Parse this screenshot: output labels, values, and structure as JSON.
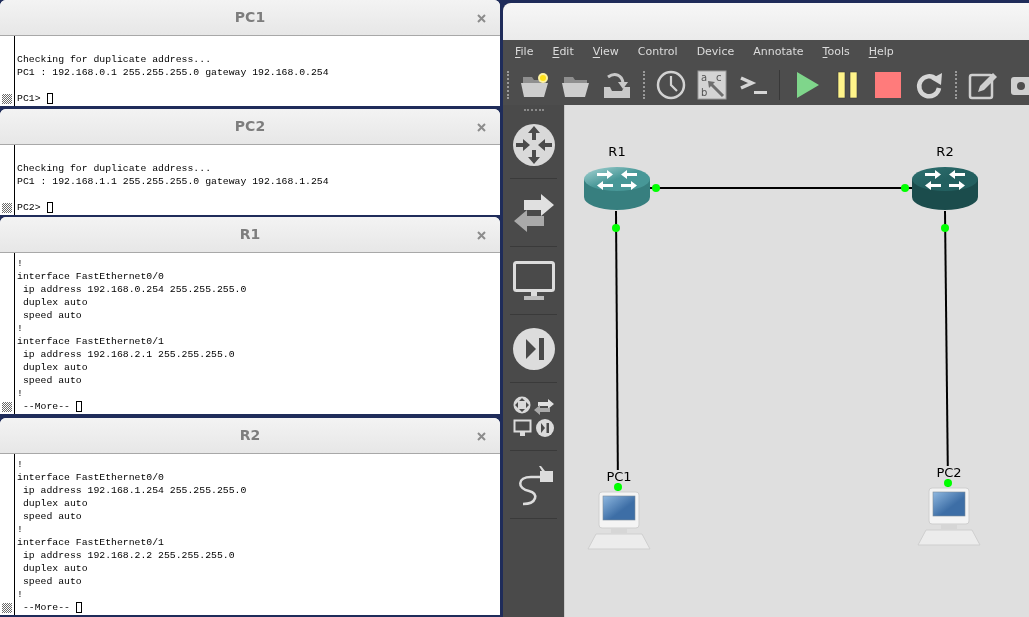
{
  "terminals": [
    {
      "title": "PC1",
      "cursor": true,
      "blocks": [
        [
          "Checking for duplicate address...",
          "PC1 : 192.168.0.1 255.255.255.0 gateway 192.168.0.254"
        ],
        [
          "PC1>"
        ]
      ]
    },
    {
      "title": "PC2",
      "cursor": true,
      "blocks": [
        [
          "Checking for duplicate address...",
          "PC1 : 192.168.1.1 255.255.255.0 gateway 192.168.1.254"
        ],
        [
          "PC2>"
        ]
      ]
    },
    {
      "title": "R1",
      "cursor": true,
      "blocks": [
        [
          "!",
          "interface FastEthernet0/0",
          " ip address 192.168.0.254 255.255.255.0",
          " duplex auto",
          " speed auto",
          "!",
          "interface FastEthernet0/1",
          " ip address 192.168.2.1 255.255.255.0",
          " duplex auto",
          " speed auto",
          "!",
          " --More--"
        ]
      ]
    },
    {
      "title": "R2",
      "cursor": true,
      "blocks": [
        [
          "!",
          "interface FastEthernet0/0",
          " ip address 192.168.1.254 255.255.255.0",
          " duplex auto",
          " speed auto",
          "!",
          "interface FastEthernet0/1",
          " ip address 192.168.2.2 255.255.255.0",
          " duplex auto",
          " speed auto",
          "!",
          " --More--"
        ]
      ]
    }
  ],
  "gns3": {
    "menu": [
      {
        "label": "File",
        "underlined": true
      },
      {
        "label": "Edit",
        "underlined": true
      },
      {
        "label": "View",
        "underlined": true
      },
      {
        "label": "Control",
        "underlined": false
      },
      {
        "label": "Device",
        "underlined": false
      },
      {
        "label": "Annotate",
        "underlined": false
      },
      {
        "label": "Tools",
        "underlined": true
      },
      {
        "label": "Help",
        "underlined": true
      }
    ],
    "toolbar": [
      {
        "kind": "handle"
      },
      {
        "kind": "new-project"
      },
      {
        "kind": "open"
      },
      {
        "kind": "import"
      },
      {
        "kind": "handle"
      },
      {
        "kind": "snapshot"
      },
      {
        "kind": "annotate-text",
        "letters": [
          "a",
          "c",
          "b"
        ]
      },
      {
        "kind": "console"
      },
      {
        "kind": "separator"
      },
      {
        "kind": "start"
      },
      {
        "kind": "suspend"
      },
      {
        "kind": "stop"
      },
      {
        "kind": "reload"
      },
      {
        "kind": "handle"
      },
      {
        "kind": "note"
      },
      {
        "kind": "screenshot"
      }
    ],
    "device_bar": [
      {
        "kind": "routers"
      },
      {
        "kind": "switches"
      },
      {
        "kind": "end-devices"
      },
      {
        "kind": "security"
      },
      {
        "kind": "all"
      },
      {
        "kind": "link"
      }
    ],
    "topology": {
      "nodes": [
        {
          "label": "R1",
          "kind": "router",
          "hovered": false
        },
        {
          "label": "R2",
          "kind": "router",
          "hovered": true
        },
        {
          "label": "PC1",
          "kind": "pc",
          "hovered": false
        },
        {
          "label": "PC2",
          "kind": "pc",
          "hovered": false
        }
      ],
      "links": [
        {
          "ends": [
            {
              "up": true
            },
            {
              "up": true
            }
          ]
        },
        {
          "ends": [
            {
              "up": true
            },
            {
              "up": true
            }
          ]
        },
        {
          "ends": [
            {
              "up": true
            },
            {
              "up": true
            }
          ]
        }
      ]
    }
  }
}
